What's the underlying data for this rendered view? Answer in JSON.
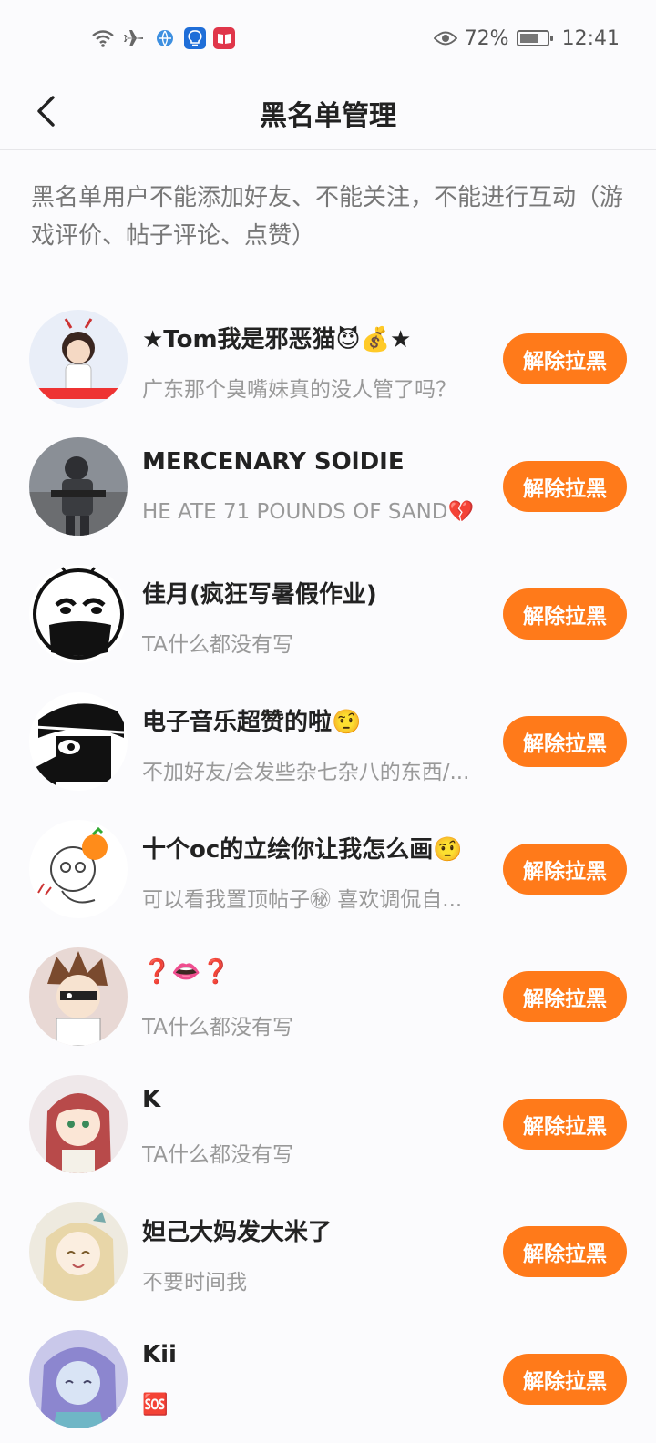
{
  "status_bar": {
    "battery_percent": "72%",
    "battery_level": 0.72,
    "time": "12:41",
    "icons": [
      "wifi-icon",
      "airplane-icon",
      "browser-icon",
      "lightbulb-app-icon",
      "book-app-icon",
      "eye-icon",
      "battery-icon"
    ]
  },
  "header": {
    "title": "黑名单管理",
    "back_icon": "chevron-left-icon"
  },
  "description": "黑名单用户不能添加好友、不能关注，不能进行互动（游戏评价、帖子评论、点赞）",
  "button_label": "解除拉黑",
  "colors": {
    "accent": "#ff7a1a",
    "background": "#fbfbfd"
  },
  "users": [
    {
      "name": "★Tom我是邪恶猫😈💰★",
      "bio": "广东那个臭嘴妹真的没人管了吗？",
      "avatar": "girl-avatar-icon"
    },
    {
      "name": "MERCENARY SOlDIE",
      "bio": "HE ATE 71 POUNDS OF SAND💔",
      "avatar": "soldier-avatar-icon"
    },
    {
      "name": "佳月(疯狂写暑假作业)",
      "bio": "TA什么都没有写",
      "avatar": "masked-face-avatar-icon"
    },
    {
      "name": "电子音乐超赞的啦🤨",
      "bio": "不加好友/会发些杂七杂八的东西/...",
      "avatar": "shadow-figure-avatar-icon"
    },
    {
      "name": "十个oc的立绘你让我怎么画🤨",
      "bio": "可以看我置顶帖子㊙ 喜欢调侃自...",
      "avatar": "orange-doodle-avatar-icon"
    },
    {
      "name": "❓👄❓",
      "bio": "TA什么都没有写",
      "avatar": "anime-boy-avatar-icon"
    },
    {
      "name": "K",
      "bio": "TA什么都没有写",
      "avatar": "anime-girl-avatar-icon"
    },
    {
      "name": "妲己大妈发大米了",
      "bio": "不要时间我",
      "avatar": "blonde-anime-avatar-icon"
    },
    {
      "name": "Kii",
      "bio": "🆘",
      "avatar": "blue-anime-avatar-icon"
    }
  ]
}
